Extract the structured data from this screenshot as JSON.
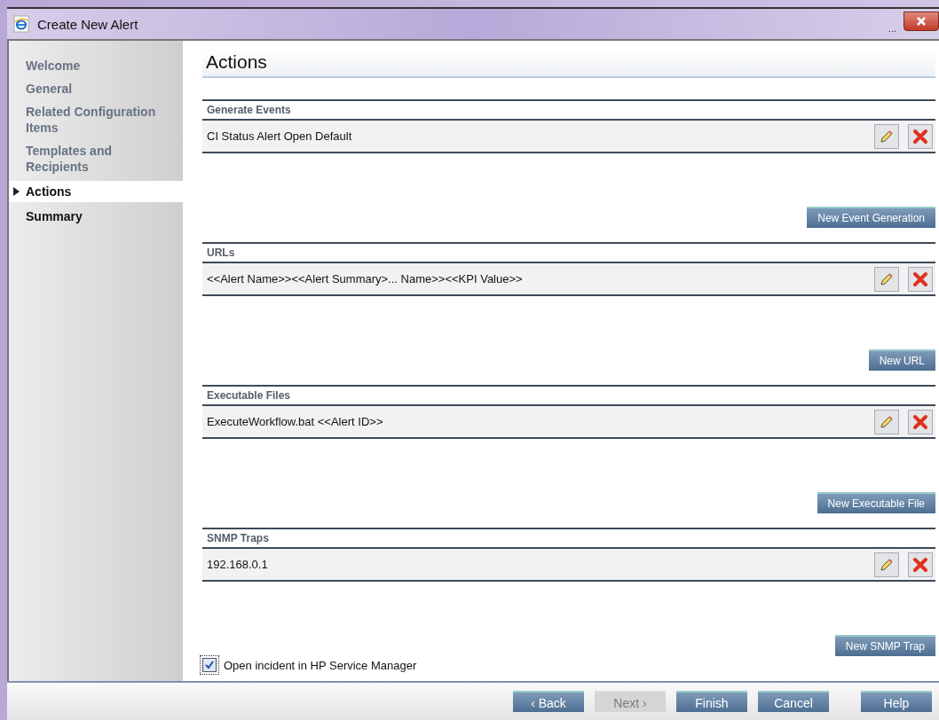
{
  "window": {
    "title": "Create New Alert",
    "overflow": "..."
  },
  "sidebar": {
    "items": [
      {
        "label": "Welcome",
        "selected": false,
        "visited": true
      },
      {
        "label": "General",
        "selected": false,
        "visited": true
      },
      {
        "label": "Related Configuration Items",
        "selected": false,
        "visited": true
      },
      {
        "label": "Templates and Recipients",
        "selected": false,
        "visited": true
      },
      {
        "label": "Actions",
        "selected": true,
        "visited": true
      },
      {
        "label": "Summary",
        "selected": false,
        "visited": false
      }
    ]
  },
  "page_title": "Actions",
  "sections": [
    {
      "title": "Generate Events",
      "row": "CI Status Alert Open Default",
      "button": "New Event Generation"
    },
    {
      "title": "URLs",
      "row": "<<Alert Name>><<Alert Summary>... Name>><<KPI Value>>",
      "button": "New URL"
    },
    {
      "title": "Executable Files",
      "row": "ExecuteWorkflow.bat <<Alert ID>>",
      "button": "New Executable File"
    },
    {
      "title": "SNMP Traps",
      "row": "192.168.0.1",
      "button": "New SNMP Trap"
    }
  ],
  "incident": {
    "label": "Open incident in HP Service Manager",
    "checked": true
  },
  "footer_buttons": [
    {
      "label": "‹ Back",
      "disabled": false
    },
    {
      "label": "Next ›",
      "disabled": true
    },
    {
      "label": "Finish",
      "disabled": false
    },
    {
      "label": "Cancel",
      "disabled": false
    },
    {
      "label": "Help",
      "disabled": false
    }
  ]
}
